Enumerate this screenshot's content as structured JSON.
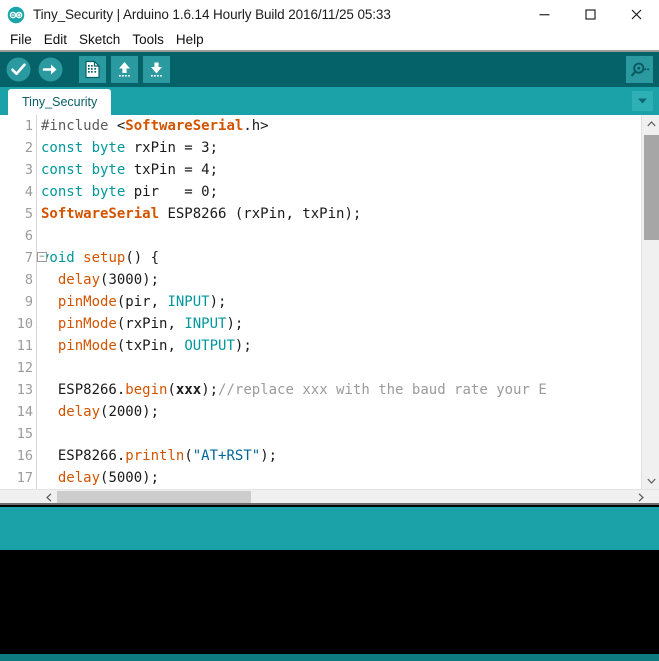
{
  "window": {
    "title": "Tiny_Security | Arduino 1.6.14 Hourly Build 2016/11/25 05:33",
    "app_icon": "arduino-logo-icon",
    "controls": {
      "minimize": "minimize-icon",
      "maximize": "maximize-icon",
      "close": "close-icon"
    }
  },
  "menubar": {
    "items": [
      {
        "label": "File"
      },
      {
        "label": "Edit"
      },
      {
        "label": "Sketch"
      },
      {
        "label": "Tools"
      },
      {
        "label": "Help"
      }
    ]
  },
  "toolbar": {
    "background": "#056269",
    "buttons": [
      {
        "name": "verify-button",
        "icon": "checkmark-icon",
        "tooltip": "Verify"
      },
      {
        "name": "upload-button",
        "icon": "arrow-right-icon",
        "tooltip": "Upload"
      },
      {
        "name": "new-button",
        "icon": "new-document-icon",
        "tooltip": "New"
      },
      {
        "name": "open-button",
        "icon": "arrow-up-icon",
        "tooltip": "Open"
      },
      {
        "name": "save-button",
        "icon": "arrow-down-icon",
        "tooltip": "Save"
      }
    ],
    "serial_monitor": {
      "name": "serial-monitor-button",
      "icon": "magnifier-icon",
      "tooltip": "Serial Monitor"
    }
  },
  "tabs": {
    "background": "#1ba2a8",
    "items": [
      {
        "label": "Tiny_Security",
        "active": true
      }
    ],
    "menu_icon": "chevron-down-icon"
  },
  "editor": {
    "first_line": 1,
    "lines": [
      {
        "number": "1",
        "fold": false,
        "tokens": [
          {
            "t": "#include ",
            "c": "k-pre"
          },
          {
            "t": "<",
            "c": "k-plain"
          },
          {
            "t": "SoftwareSerial",
            "c": "k-lib"
          },
          {
            "t": ".h>",
            "c": "k-plain"
          }
        ]
      },
      {
        "number": "2",
        "fold": false,
        "tokens": [
          {
            "t": "const byte",
            "c": "k-type"
          },
          {
            "t": " rxPin = 3;",
            "c": "k-plain"
          }
        ]
      },
      {
        "number": "3",
        "fold": false,
        "tokens": [
          {
            "t": "const byte",
            "c": "k-type"
          },
          {
            "t": " txPin = 4;",
            "c": "k-plain"
          }
        ]
      },
      {
        "number": "4",
        "fold": false,
        "tokens": [
          {
            "t": "const byte",
            "c": "k-type"
          },
          {
            "t": " pir   = 0;",
            "c": "k-plain"
          }
        ]
      },
      {
        "number": "5",
        "fold": false,
        "tokens": [
          {
            "t": "SoftwareSerial",
            "c": "k-lib"
          },
          {
            "t": " ESP8266 (rxPin, txPin);",
            "c": "k-plain"
          }
        ]
      },
      {
        "number": "6",
        "fold": false,
        "tokens": []
      },
      {
        "number": "7",
        "fold": true,
        "tokens": [
          {
            "t": "void",
            "c": "k-type"
          },
          {
            "t": " ",
            "c": "k-plain"
          },
          {
            "t": "setup",
            "c": "k-fn"
          },
          {
            "t": "() {",
            "c": "k-plain"
          }
        ]
      },
      {
        "number": "8",
        "fold": false,
        "tokens": [
          {
            "t": "  ",
            "c": "k-plain"
          },
          {
            "t": "delay",
            "c": "k-fn"
          },
          {
            "t": "(3000);",
            "c": "k-plain"
          }
        ]
      },
      {
        "number": "9",
        "fold": false,
        "tokens": [
          {
            "t": "  ",
            "c": "k-plain"
          },
          {
            "t": "pinMode",
            "c": "k-fn"
          },
          {
            "t": "(pir, ",
            "c": "k-plain"
          },
          {
            "t": "INPUT",
            "c": "k-const"
          },
          {
            "t": ");",
            "c": "k-plain"
          }
        ]
      },
      {
        "number": "10",
        "fold": false,
        "tokens": [
          {
            "t": "  ",
            "c": "k-plain"
          },
          {
            "t": "pinMode",
            "c": "k-fn"
          },
          {
            "t": "(rxPin, ",
            "c": "k-plain"
          },
          {
            "t": "INPUT",
            "c": "k-const"
          },
          {
            "t": ");",
            "c": "k-plain"
          }
        ]
      },
      {
        "number": "11",
        "fold": false,
        "tokens": [
          {
            "t": "  ",
            "c": "k-plain"
          },
          {
            "t": "pinMode",
            "c": "k-fn"
          },
          {
            "t": "(txPin, ",
            "c": "k-plain"
          },
          {
            "t": "OUTPUT",
            "c": "k-const"
          },
          {
            "t": ");",
            "c": "k-plain"
          }
        ]
      },
      {
        "number": "12",
        "fold": false,
        "tokens": []
      },
      {
        "number": "13",
        "fold": false,
        "tokens": [
          {
            "t": "  ESP8266.",
            "c": "k-plain"
          },
          {
            "t": "begin",
            "c": "k-fn"
          },
          {
            "t": "(",
            "c": "k-plain"
          },
          {
            "t": "xxx",
            "c": "k-bold"
          },
          {
            "t": ");",
            "c": "k-plain"
          },
          {
            "t": "//replace xxx with the baud rate your E",
            "c": "k-cmt"
          }
        ]
      },
      {
        "number": "14",
        "fold": false,
        "tokens": [
          {
            "t": "  ",
            "c": "k-plain"
          },
          {
            "t": "delay",
            "c": "k-fn"
          },
          {
            "t": "(2000);",
            "c": "k-plain"
          }
        ]
      },
      {
        "number": "15",
        "fold": false,
        "tokens": []
      },
      {
        "number": "16",
        "fold": false,
        "tokens": [
          {
            "t": "  ESP8266.",
            "c": "k-plain"
          },
          {
            "t": "println",
            "c": "k-fn"
          },
          {
            "t": "(",
            "c": "k-plain"
          },
          {
            "t": "\"AT+RST\"",
            "c": "k-str"
          },
          {
            "t": ");",
            "c": "k-plain"
          }
        ]
      },
      {
        "number": "17",
        "fold": false,
        "tokens": [
          {
            "t": "  ",
            "c": "k-plain"
          },
          {
            "t": "delay",
            "c": "k-fn"
          },
          {
            "t": "(5000);",
            "c": "k-plain"
          }
        ]
      }
    ],
    "vscroll": {
      "up_icon": "chevron-up-icon",
      "down_icon": "chevron-down-icon"
    },
    "hscroll": {
      "left_icon": "chevron-left-icon",
      "right_icon": "chevron-right-icon"
    }
  },
  "statusbar": {
    "text": "",
    "background": "#1ba2a8"
  },
  "console": {
    "text": "",
    "background": "#000000"
  },
  "bottombar": {
    "background": "#0d7a80"
  }
}
